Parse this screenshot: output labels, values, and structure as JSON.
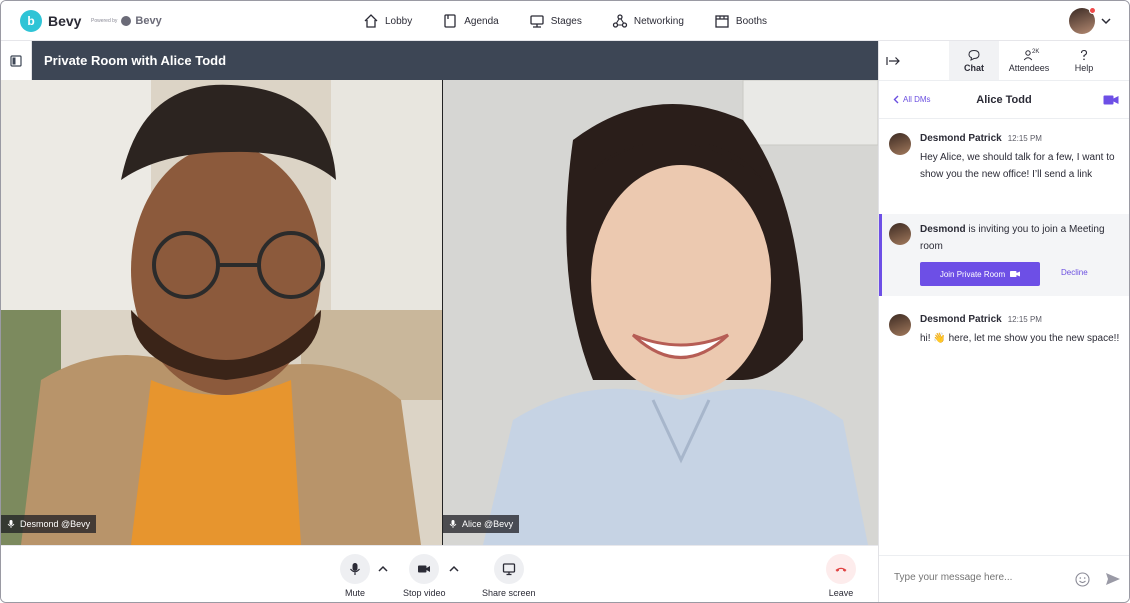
{
  "brand": {
    "name": "Bevy",
    "powered_by": "Powered by",
    "powered_name": "Bevy"
  },
  "nav": [
    {
      "label": "Lobby",
      "icon": "home-icon"
    },
    {
      "label": "Agenda",
      "icon": "agenda-icon"
    },
    {
      "label": "Stages",
      "icon": "stage-icon"
    },
    {
      "label": "Networking",
      "icon": "networking-icon"
    },
    {
      "label": "Booths",
      "icon": "booth-icon"
    }
  ],
  "room": {
    "title": "Private Room with Alice Todd"
  },
  "participants": [
    {
      "name": "Desmond @Bevy"
    },
    {
      "name": "Alice @Bevy"
    }
  ],
  "controls": {
    "mute": "Mute",
    "stop_video": "Stop video",
    "share_screen": "Share screen",
    "leave": "Leave"
  },
  "side": {
    "tabs": [
      {
        "label": "Chat",
        "active": true
      },
      {
        "label": "Attendees",
        "badge": "2K"
      },
      {
        "label": "Help"
      }
    ],
    "back_label": "All DMs",
    "dm_title": "Alice Todd"
  },
  "messages": [
    {
      "author": "Desmond Patrick",
      "time": "12:15 PM",
      "text": "Hey Alice, we should talk for a few, I want to show you the new office! I’ll send a link"
    },
    {
      "author": "Desmond Patrick",
      "time": "12:15 PM",
      "text": "hi! 👋 here, let me show you the new space!!"
    }
  ],
  "invite": {
    "author": "Desmond",
    "text": " is inviting you to join a Meeting room",
    "join_label": "Join Private Room",
    "decline_label": "Decline"
  },
  "composer": {
    "placeholder": "Type your message here..."
  },
  "colors": {
    "accent": "#6d4fe6",
    "header": "#3d4655",
    "brand": "#2fc4d6",
    "leave": "#e04444"
  }
}
